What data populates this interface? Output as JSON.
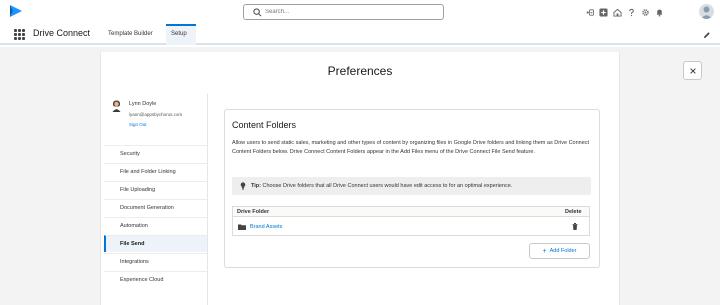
{
  "header": {
    "search_placeholder": "Search...",
    "icons": [
      "setup-menu-icon",
      "add-icon",
      "home-icon",
      "help-icon",
      "gear-icon",
      "bell-icon",
      "avatar"
    ]
  },
  "nav": {
    "app_name": "Drive Connect",
    "tabs": [
      {
        "label": "Template Builder",
        "active": false
      },
      {
        "label": "Setup",
        "active": true
      }
    ]
  },
  "page": {
    "title": "Preferences"
  },
  "user": {
    "name": "Lynn Doyle",
    "email": "lyann@appsbychorus.com",
    "sign_out": "Sign Out"
  },
  "sidebar": {
    "items": [
      {
        "label": "Security",
        "active": false
      },
      {
        "label": "File and Folder Linking",
        "active": false
      },
      {
        "label": "File Uploading",
        "active": false
      },
      {
        "label": "Document Generation",
        "active": false
      },
      {
        "label": "Automation",
        "active": false
      },
      {
        "label": "File Send",
        "active": true
      },
      {
        "label": "Integrations",
        "active": false
      },
      {
        "label": "Experience Cloud",
        "active": false
      }
    ]
  },
  "content": {
    "title": "Content Folders",
    "description": "Allow users to send static sales, marketing and other types of content by organizing files in Google Drive folders and linking them as Drive Connect Content Folders below. Drive Connect Content Folders appear in the Add Files menu of the Drive Connect File Send feature.",
    "tip_label": "Tip:",
    "tip_text": "Choose Drive folders that all Drive Connect users would have edit access to for an optimal experience.",
    "table": {
      "col_folder": "Drive Folder",
      "col_delete": "Delete",
      "rows": [
        {
          "folder": "Brand Assets"
        }
      ]
    },
    "add_button": "Add Folder"
  },
  "colors": {
    "brand": "#0176d3",
    "page_bg": "#f3f3f3"
  }
}
